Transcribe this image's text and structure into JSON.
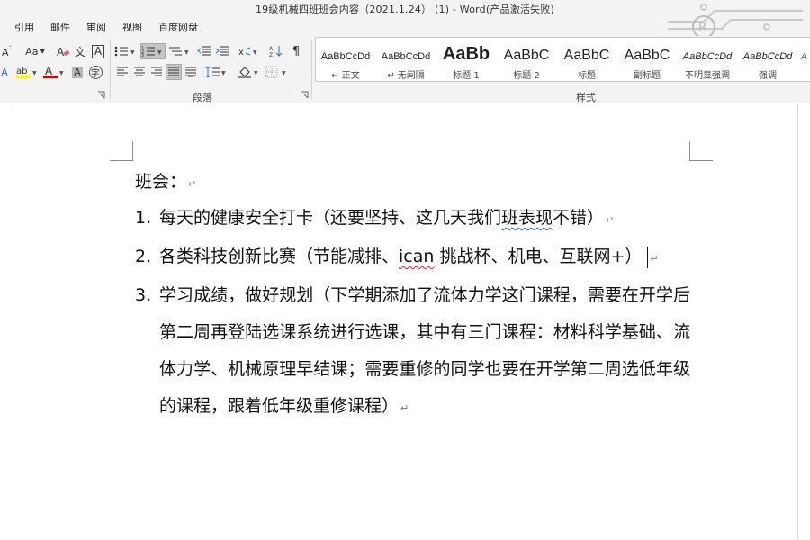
{
  "window": {
    "title": "19级机械四班班会内容（2021.1.24） (1) - Word(产品激活失败)"
  },
  "menu": {
    "items": [
      "引用",
      "邮件",
      "审阅",
      "视图",
      "百度网盘"
    ]
  },
  "ribbon": {
    "font_group": {
      "font_size_glyph": "Aa",
      "clear_format_glyph": "A",
      "phonetic_glyph": "文",
      "char_border_glyph": "A",
      "font_color_glyph": "A",
      "char_shading_glyph": "A",
      "enclose_glyph": "字",
      "highlight_color": "#ffff00",
      "font_color": "#d00000"
    },
    "paragraph_group": {
      "label": "段落"
    },
    "styles_group": {
      "label": "样式",
      "styles": [
        {
          "preview": "AaBbCcDd",
          "name": "↵ 正文"
        },
        {
          "preview": "AaBbCcDd",
          "name": "↵ 无间隔"
        },
        {
          "preview": "AaBb",
          "name": "标题 1"
        },
        {
          "preview": "AaBbC",
          "name": "标题 2"
        },
        {
          "preview": "AaBbC",
          "name": "标题"
        },
        {
          "preview": "AaBbC",
          "name": "副标题"
        },
        {
          "preview": "AaBbCcDd",
          "name": "不明显强调"
        },
        {
          "preview": "AaBbCcDd",
          "name": "强调"
        },
        {
          "preview": "A",
          "name": ""
        }
      ]
    }
  },
  "document": {
    "heading": "班会：",
    "items": [
      {
        "number": "1.",
        "text_a": "每天的健康安全打卡（还要坚持、这几天我们",
        "text_flag": "班表现",
        "text_b": "不错）"
      },
      {
        "number": "2.",
        "text_a": "各类科技创新比赛（节能减排、",
        "text_flag": "ican",
        "text_b": " 挑战杯、机电、互联网+）"
      },
      {
        "number": "3.",
        "text": "学习成绩，做好规划（下学期添加了流体力学这门课程，需要在开学后第二周再登陆选课系统进行选课，其中有三门课程：材料科学基础、流体力学、机械原理早结课；需要重修的同学也要在开学第二周选低年级的课程，跟着低年级重修课程）"
      }
    ],
    "paragraph_mark": "↵"
  }
}
